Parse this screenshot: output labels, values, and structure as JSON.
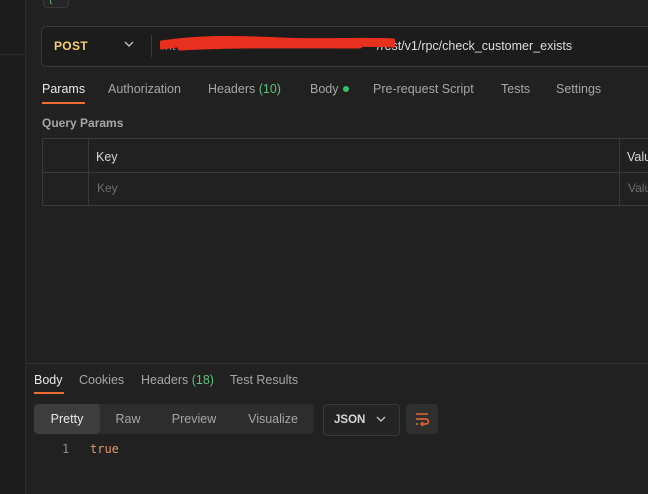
{
  "request": {
    "method": "POST",
    "url_visible": "/rest/v1/rpc/check_customer_exists"
  },
  "request_tabs": {
    "params": "Params",
    "authorization": "Authorization",
    "headers_label": "Headers",
    "headers_count": "(10)",
    "body": "Body",
    "prerequest": "Pre-request Script",
    "tests": "Tests",
    "settings": "Settings"
  },
  "query_params": {
    "title": "Query Params",
    "col_key": "Key",
    "col_value": "Valu",
    "key_placeholder": "Key",
    "value_placeholder": "Valu"
  },
  "response_tabs": {
    "body": "Body",
    "cookies": "Cookies",
    "headers_label": "Headers",
    "headers_count": "(18)",
    "test_results": "Test Results"
  },
  "response_view": {
    "formats": [
      "Pretty",
      "Raw",
      "Preview",
      "Visualize"
    ],
    "active_format": "Pretty",
    "language": "JSON"
  },
  "response_body": {
    "lines": [
      {
        "no": "1",
        "text": "true"
      }
    ]
  },
  "colors": {
    "accent": "#ef6d34",
    "method": "#f7d06b",
    "count": "#5ec27a",
    "body_dot": "#33c26b",
    "value_text": "#e4946b"
  },
  "icons": {
    "method_dropdown": "chevron-down-icon",
    "language_dropdown": "chevron-down-icon",
    "wrap": "wrap-lines-icon"
  }
}
